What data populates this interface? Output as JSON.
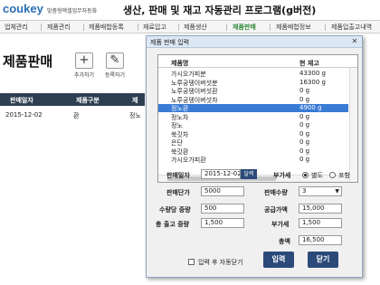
{
  "header": {
    "logo": "coukey",
    "logo_sub": "맞춤형엑셀업무자동화",
    "title": "생산, 판매 및 재고 자동관리 프로그램(g버전)"
  },
  "menu": [
    "업체관리",
    "제품관리",
    "제품배합등록",
    "재료입고",
    "제품생산",
    "제품판매",
    "제품배합정보",
    "제품입출고내역"
  ],
  "page": {
    "title": "제품판매",
    "add_label": "추가하기",
    "register_label": "등록하기"
  },
  "table": {
    "headers": [
      "판매일자",
      "제품구분",
      "제"
    ],
    "rows": [
      [
        "2015-12-02",
        "환",
        "정노"
      ]
    ]
  },
  "dialog": {
    "title": "제품 판매 입력",
    "close_icon": "close-icon",
    "list_headers": [
      "제품명",
      "현 재고"
    ],
    "items": [
      {
        "name": "가시오가피분",
        "stock": "43300 g"
      },
      {
        "name": "노루궁뎅이버섯분",
        "stock": "16300 g"
      },
      {
        "name": "노루궁뎅이버섯환",
        "stock": "0 g"
      },
      {
        "name": "노루궁뎅이버섯차",
        "stock": "0 g"
      },
      {
        "name": "정노환",
        "stock": "4900 g"
      },
      {
        "name": "정노차",
        "stock": "0 g"
      },
      {
        "name": "정노",
        "stock": "0 g"
      },
      {
        "name": "쑥갓차",
        "stock": "0 g"
      },
      {
        "name": "은단",
        "stock": "0 g"
      },
      {
        "name": "쑥갓환",
        "stock": "0 g"
      },
      {
        "name": "가시오가피환",
        "stock": "0 g"
      }
    ],
    "selected_index": 4,
    "sale_date_label": "판매일자",
    "sale_date": "2015-12-02",
    "date_button": "달력",
    "vat_label": "부가세",
    "vat_options": [
      "별도",
      "포함"
    ],
    "vat_selected": "별도",
    "unit_price_label": "판매단가",
    "unit_price": "5000",
    "qty_label": "판매수량",
    "qty": "3",
    "unit_weight_label": "수량당 중량",
    "unit_weight": "500",
    "supply_label": "공급가액",
    "supply": "15,000",
    "total_weight_label": "총 출고 중량",
    "total_weight": "1,500",
    "vat_amount_label": "부가세",
    "vat_amount": "1,500",
    "total_label": "총액",
    "total": "16,500",
    "auto_close_label": "입력 후 자동닫기",
    "input_button": "입력",
    "close_button": "닫기"
  },
  "colors": {
    "accent": "#2b4a7a",
    "selection": "#3a7bd5",
    "active_menu": "#2f8a3a",
    "table_header": "#2e3f52"
  }
}
